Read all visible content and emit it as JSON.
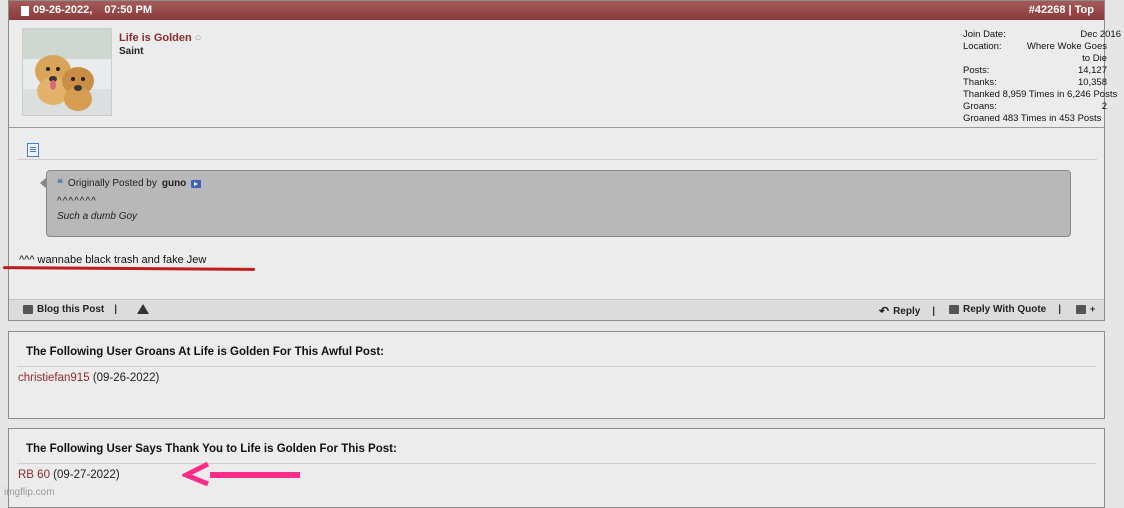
{
  "post": {
    "date": "09-26-2022,",
    "time": "07:50 PM",
    "post_number": "#42268",
    "top_label": "Top",
    "username": "Life is Golden",
    "user_title": "Saint",
    "stats": {
      "join_label": "Join Date:",
      "join_value": "Dec 2016",
      "location_label": "Location:",
      "location_value_1": "Where Woke Goes",
      "location_value_2": "to Die",
      "posts_label": "Posts:",
      "posts_value": "14,127",
      "thanks_label": "Thanks:",
      "thanks_value": "10,358",
      "thanked": "Thanked 8,959 Times in 6,246 Posts",
      "groans_label": "Groans:",
      "groans_value": "2",
      "groaned": "Groaned 483 Times in 453 Posts"
    },
    "quote": {
      "prefix": "Originally Posted by",
      "poster": "guno",
      "line1": "^^^^^^^",
      "line2": "Such a dumb Goy"
    },
    "message": "^^^ wannabe black trash and fake Jew",
    "footer": {
      "blog": "Blog this Post",
      "reply": "Reply",
      "reply_quote": "Reply With Quote"
    }
  },
  "groans": {
    "title": "The Following User Groans At Life is Golden For This Awful Post:",
    "user": "christiefan915",
    "date": "(09-26-2022)"
  },
  "thanks": {
    "title": "The Following User Says Thank You to Life is Golden For This Post:",
    "user": "RB 60",
    "date": "(09-27-2022)"
  },
  "watermark": "imgflip.com",
  "colors": {
    "header": "#8a3a3a",
    "username": "#8b2c2c",
    "annotation_red": "#c01c1c",
    "annotation_pink": "#ff2d8a"
  }
}
